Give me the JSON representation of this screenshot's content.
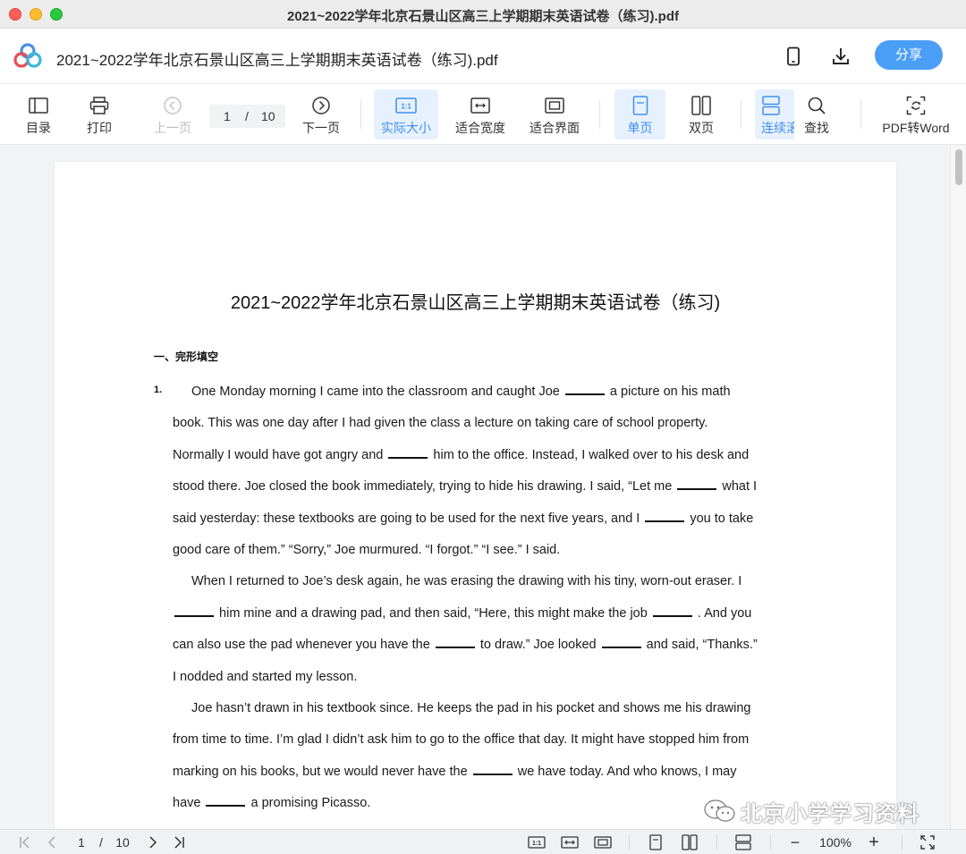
{
  "window": {
    "title": "2021~2022学年北京石景山区高三上学期期末英语试卷（练习).pdf"
  },
  "header": {
    "doc_title": "2021~2022学年北京石景山区高三上学期期末英语试卷（练习).pdf",
    "share_label": "分享",
    "icons": [
      "app-logo-icon",
      "phone-icon",
      "download-icon"
    ]
  },
  "toolbar": {
    "toc": "目录",
    "print": "打印",
    "prev": "上一页",
    "page_current": "1",
    "page_sep": "/",
    "page_total": "10",
    "next": "下一页",
    "actual_size": "实际大小",
    "fit_width": "适合宽度",
    "fit_page": "适合界面",
    "single": "单页",
    "double": "双页",
    "continuous": "连续滚",
    "find": "查找",
    "pdf_to_word": "PDF转Word",
    "actual_size_icon_text": "1:1"
  },
  "document": {
    "title": "2021~2022学年北京石景山区高三上学期期末英语试卷（练习)",
    "section": "一、完形填空",
    "question_number": "1.",
    "lines": [
      [
        "One Monday morning I came into the classroom and caught Joe ",
        " a picture on his math"
      ],
      [
        "book. This was one day after I had given the class a lecture on taking care of school property."
      ],
      [
        "Normally I would have got angry and ",
        " him to the office. Instead, I walked over to his desk and"
      ],
      [
        "stood there. Joe closed the book immediately, trying to hide his drawing. I said, “Let me ",
        " what I"
      ],
      [
        "said yesterday: these textbooks are going to be used for the next five years, and I ",
        " you to take"
      ],
      [
        "good care of them.” “Sorry,” Joe murmured. “I forgot.” “I see.” I said."
      ],
      [
        "When I returned to Joe’s desk again, he was erasing the drawing with his tiny, worn-out eraser. I"
      ],
      [
        "",
        " him mine and a drawing pad, and then said, “Here, this might make the job ",
        " . And you"
      ],
      [
        "can also use the pad whenever you have the ",
        " to draw.” Joe looked ",
        " and said, “Thanks.”"
      ],
      [
        "I nodded and started my lesson."
      ],
      [
        "Joe hasn’t drawn in his textbook since. He keeps the pad in his pocket and shows me his drawing"
      ],
      [
        "from time to time. I’m glad I didn’t ask him to go to the office that day. It might have stopped him from"
      ],
      [
        "marking on his books, but we would never have the ",
        " we have today. And who knows, I may"
      ],
      [
        "have ",
        " a promising Picasso."
      ]
    ]
  },
  "bottombar": {
    "page_current": "1",
    "page_sep": "/",
    "page_total": "10",
    "zoom": "100%",
    "zoom_minus": "−",
    "zoom_plus": "+",
    "actual_size_icon_text": "1:1"
  },
  "watermark": {
    "text": "北京小学学习资料"
  },
  "colors": {
    "accent": "#3d8ff0",
    "share_button": "#4b9ef5",
    "active_tool_bg": "#e7f1fd"
  }
}
